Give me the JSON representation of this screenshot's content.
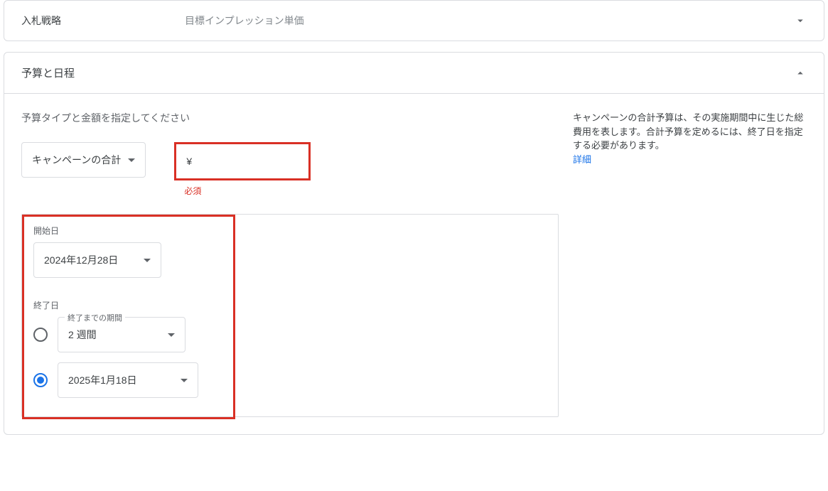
{
  "bidding": {
    "label": "入札戦略",
    "value": "目標インプレッション単価"
  },
  "budget": {
    "header": "予算と日程",
    "instruction": "予算タイプと金額を指定してください",
    "type_label": "キャンペーンの合計",
    "currency": "¥",
    "error": "必須",
    "help_text": "キャンペーンの合計予算は、その実施期間中に生じた総費用を表します。合計予算を定めるには、終了日を指定する必要があります。",
    "help_link": "詳細",
    "dates": {
      "start_label": "開始日",
      "start_value": "2024年12月28日",
      "end_label": "終了日",
      "period_label": "終了までの期間",
      "period_value": "2 週間",
      "end_value": "2025年1月18日"
    }
  }
}
